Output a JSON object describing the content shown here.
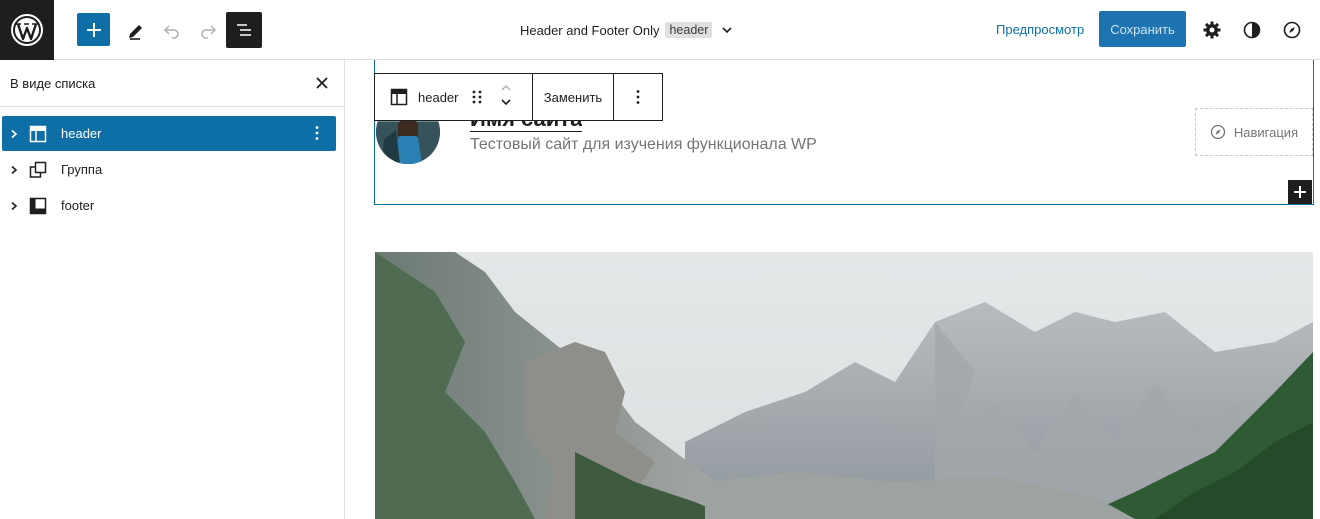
{
  "topbar": {
    "logo_icon": "wordpress-logo-icon",
    "add_icon": "plus-icon",
    "edit_icon": "pencil-icon",
    "undo_icon": "undo-icon",
    "redo_icon": "redo-icon",
    "list_view_icon": "list-view-icon",
    "document_title": "Header and Footer Only",
    "document_badge": "header",
    "preview_label": "Предпросмотр",
    "save_label": "Сохранить",
    "colors": {
      "primary": "#0d6fa5",
      "dark": "#1e1e1e"
    }
  },
  "list_view": {
    "title": "В виде списка",
    "items": [
      {
        "label": "header",
        "icon": "template-part-header-icon",
        "selected": true
      },
      {
        "label": "Группа",
        "icon": "group-icon",
        "selected": false
      },
      {
        "label": "footer",
        "icon": "template-part-footer-icon",
        "selected": false
      }
    ]
  },
  "block_toolbar": {
    "block_name": "header",
    "replace_label": "Заменить"
  },
  "canvas": {
    "site_title": "Имя сайта",
    "site_tagline": "Тестовый сайт для изучения функционала WP",
    "navigation_label": "Навигация"
  }
}
